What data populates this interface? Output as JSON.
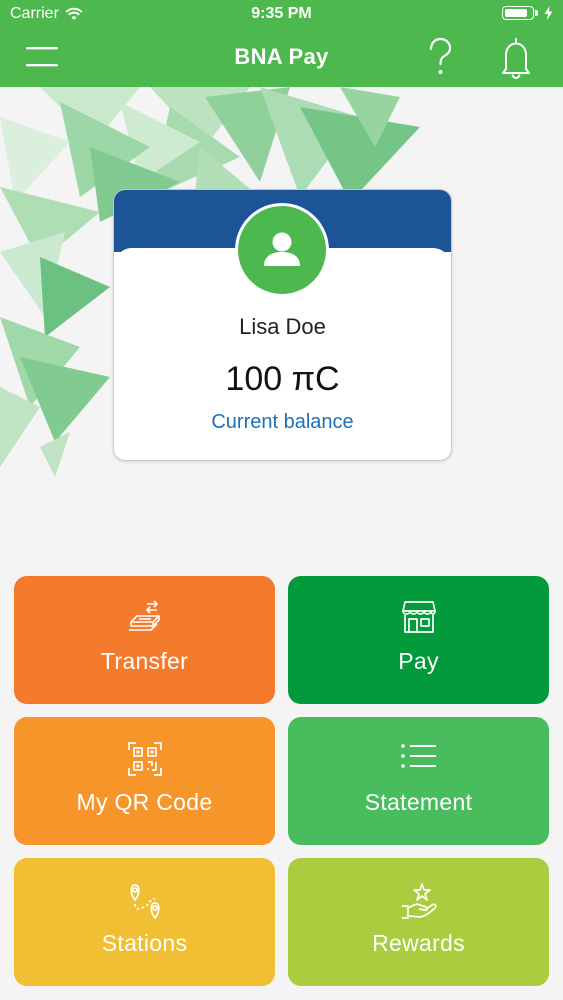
{
  "status_bar": {
    "carrier": "Carrier",
    "time": "9:35 PM",
    "battery_level": 0.9
  },
  "header": {
    "title": "BNA Pay",
    "menu_icon": "hamburger-icon",
    "help_icon": "question-icon",
    "bell_icon": "bell-icon"
  },
  "account": {
    "name": "Lisa Doe",
    "balance": "100 πC",
    "balance_label": "Current balance"
  },
  "tiles": [
    {
      "label": "Transfer",
      "icon": "money-transfer-icon",
      "color": "#f47a2c"
    },
    {
      "label": "Pay",
      "icon": "storefront-icon",
      "color": "#029a3a"
    },
    {
      "label": "My QR Code",
      "icon": "qr-code-icon",
      "color": "#f5952a"
    },
    {
      "label": "Statement",
      "icon": "list-icon",
      "color": "#49bd5e"
    },
    {
      "label": "Stations",
      "icon": "map-route-icon",
      "color": "#f0bf33"
    },
    {
      "label": "Rewards",
      "icon": "reward-hand-icon",
      "color": "#abcc3f"
    }
  ],
  "colors": {
    "header": "#4cb84d",
    "card_band": "#1b5597",
    "avatar": "#4cb84d",
    "balance_label": "#1f6fb5"
  }
}
